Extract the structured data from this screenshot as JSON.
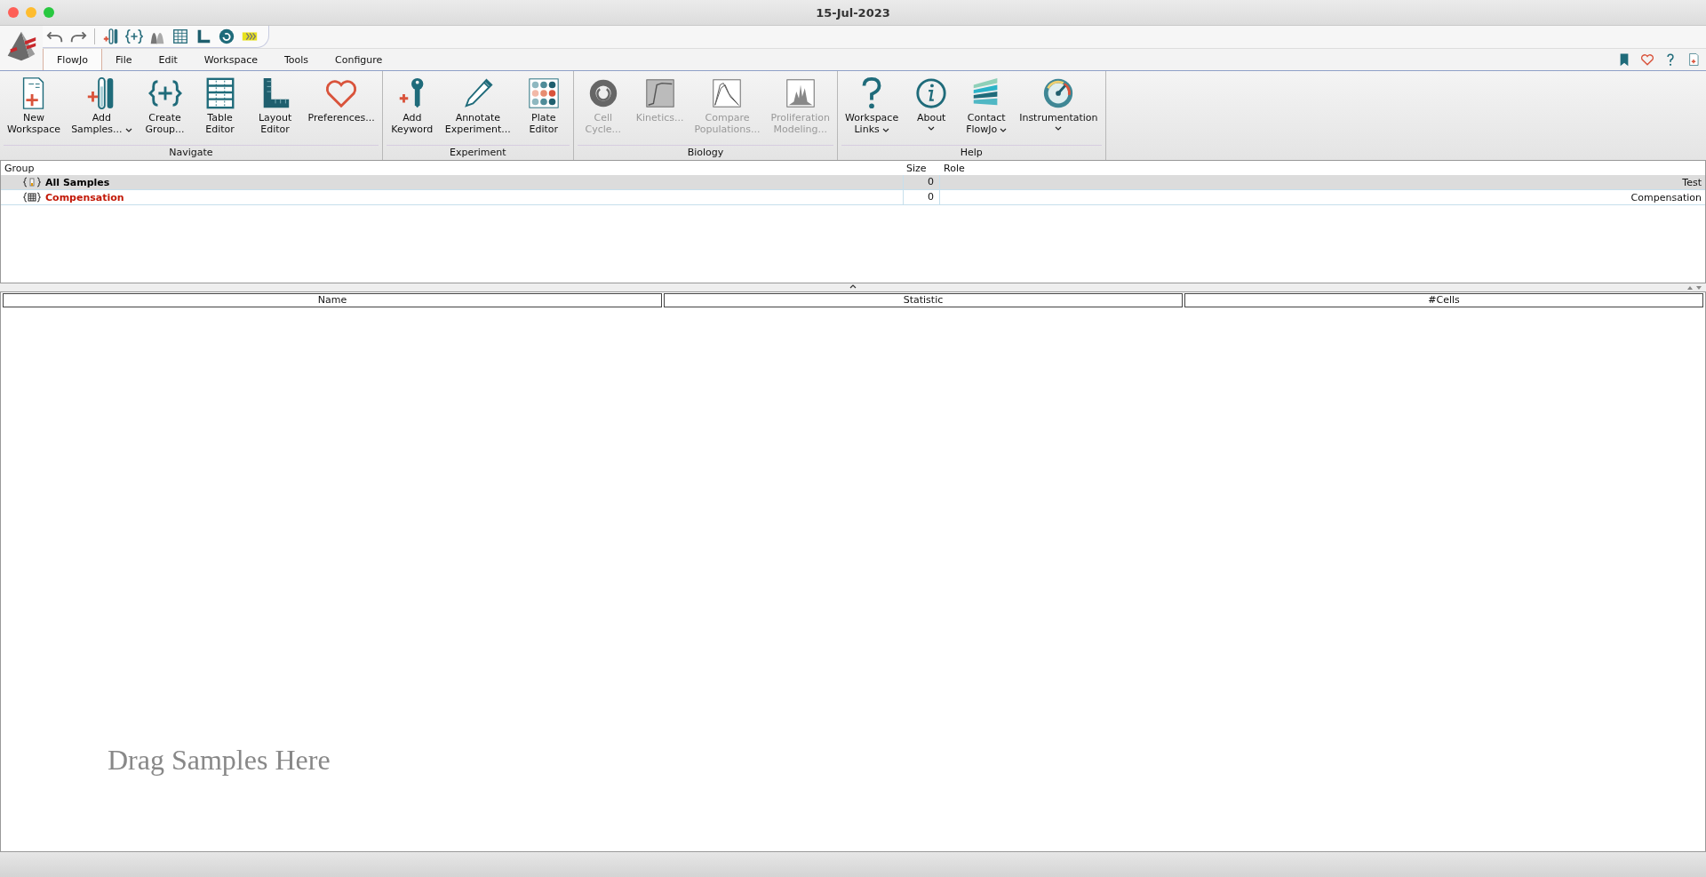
{
  "window": {
    "title": "15-Jul-2023"
  },
  "menu_tabs": [
    {
      "label": "FlowJo",
      "selected": true
    },
    {
      "label": "File",
      "selected": false
    },
    {
      "label": "Edit",
      "selected": false
    },
    {
      "label": "Workspace",
      "selected": false
    },
    {
      "label": "Tools",
      "selected": false
    },
    {
      "label": "Configure",
      "selected": false
    }
  ],
  "ribbon": [
    {
      "title": "Navigate",
      "buttons": [
        {
          "label": "New\nWorkspace",
          "disabled": false,
          "dropdown": false
        },
        {
          "label": "Add\nSamples...",
          "disabled": false,
          "dropdown": true
        },
        {
          "label": "Create\nGroup...",
          "disabled": false,
          "dropdown": false
        },
        {
          "label": "Table\nEditor",
          "disabled": false,
          "dropdown": false
        },
        {
          "label": "Layout\nEditor",
          "disabled": false,
          "dropdown": false
        },
        {
          "label": "Preferences...",
          "disabled": false,
          "dropdown": false
        }
      ]
    },
    {
      "title": "Experiment",
      "buttons": [
        {
          "label": "Add\nKeyword",
          "disabled": false,
          "dropdown": false
        },
        {
          "label": "Annotate\nExperiment...",
          "disabled": false,
          "dropdown": false
        },
        {
          "label": "Plate\nEditor",
          "disabled": false,
          "dropdown": false
        }
      ]
    },
    {
      "title": "Biology",
      "buttons": [
        {
          "label": "Cell\nCycle...",
          "disabled": true,
          "dropdown": false
        },
        {
          "label": "Kinetics...",
          "disabled": true,
          "dropdown": false
        },
        {
          "label": "Compare\nPopulations...",
          "disabled": true,
          "dropdown": false
        },
        {
          "label": "Proliferation\nModeling...",
          "disabled": true,
          "dropdown": false
        }
      ]
    },
    {
      "title": "Help",
      "buttons": [
        {
          "label": "Workspace\nLinks",
          "disabled": false,
          "dropdown": true
        },
        {
          "label": "About",
          "disabled": false,
          "dropdown": true
        },
        {
          "label": "Contact\nFlowJo",
          "disabled": false,
          "dropdown": true
        },
        {
          "label": "Instrumentation",
          "disabled": false,
          "dropdown": true
        }
      ]
    }
  ],
  "groups_table": {
    "columns": [
      "Group",
      "Size",
      "Role"
    ],
    "rows": [
      {
        "kind": "samples",
        "name": "All Samples",
        "size": "0",
        "role": "Test",
        "selected": true,
        "color": "#000000"
      },
      {
        "kind": "compensation",
        "name": "Compensation",
        "size": "0",
        "role": "Compensation",
        "selected": false,
        "color": "#c21807"
      }
    ]
  },
  "samples_table": {
    "columns": [
      "Name",
      "Statistic",
      "#Cells"
    ],
    "placeholder": "Drag Samples Here"
  }
}
